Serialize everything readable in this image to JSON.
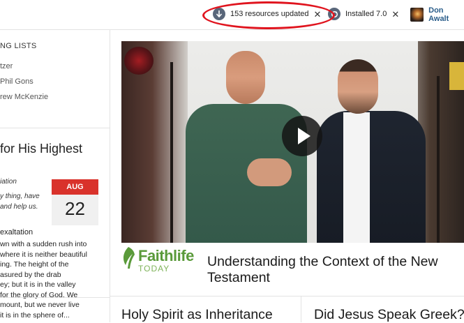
{
  "topbar": {
    "resources_notification": {
      "text": "153 resources updated",
      "icon": "download-arrow-icon"
    },
    "install_notification": {
      "text": "Installed 7.0",
      "icon": "refresh-icon"
    },
    "close_symbol": "✕",
    "user_name": "Don Awalt"
  },
  "sidebar": {
    "lists_title": "NG LISTS",
    "list_items": [
      "tzer",
      "Phil Gons",
      "rew McKenzie"
    ]
  },
  "devotional": {
    "title": "for His Highest",
    "subtitle": "iation",
    "quote": "y thing, have and help us.",
    "date_month": "AUG",
    "date_day": "22",
    "heading": "exaltation",
    "body_lines": [
      "wn with a sudden rush into",
      "where it is neither beautiful",
      "ing. The height of the",
      "asured by the drab",
      "ey; but it is in the valley",
      "for the glory of God. We",
      "mount, but we never live",
      "it is in the sphere of..."
    ]
  },
  "video": {
    "title": "Understanding the Context of the New Testament",
    "logo_word": "Faithlife",
    "logo_sub": "TODAY"
  },
  "cards": {
    "card1_title": "Holy Spirit as Inheritance",
    "card2_title": "Did Jesus Speak Greek?"
  },
  "colors": {
    "accent_red": "#d9322b",
    "highlight_red": "#e0141e",
    "link_blue": "#2a5d8a",
    "faithlife_green": "#5a9a3a"
  }
}
